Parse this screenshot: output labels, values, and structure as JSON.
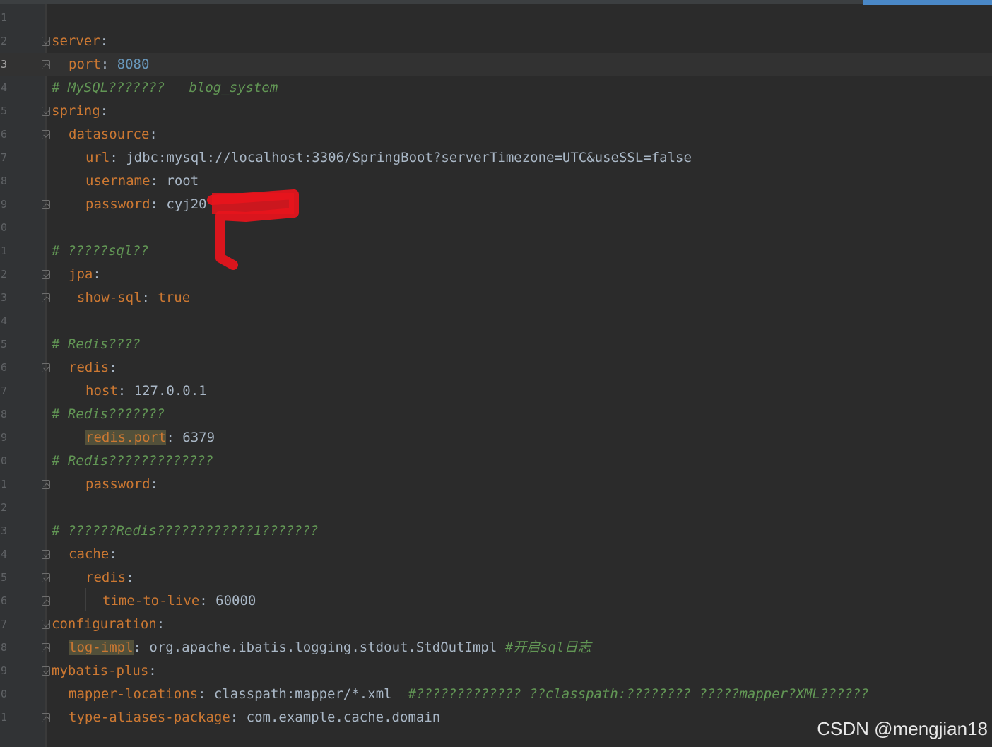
{
  "editor": {
    "file_type": "yaml",
    "current_line": 3,
    "lines": [
      {
        "num": "1",
        "fold": "",
        "indent": 0,
        "parts": []
      },
      {
        "num": "2",
        "fold": "open",
        "indent": 0,
        "parts": [
          {
            "t": "server",
            "c": "key"
          },
          {
            "t": ":",
            "c": "val"
          }
        ]
      },
      {
        "num": "3",
        "fold": "close",
        "indent": 1,
        "parts": [
          {
            "t": "port",
            "c": "key"
          },
          {
            "t": ": ",
            "c": "val"
          },
          {
            "t": "8080",
            "c": "num"
          }
        ]
      },
      {
        "num": "4",
        "fold": "",
        "indent": 0,
        "parts": [
          {
            "t": "# MySQL???????   blog_system",
            "c": "cmt"
          }
        ]
      },
      {
        "num": "5",
        "fold": "open",
        "indent": 0,
        "parts": [
          {
            "t": "spring",
            "c": "key"
          },
          {
            "t": ":",
            "c": "val"
          }
        ]
      },
      {
        "num": "6",
        "fold": "open",
        "indent": 1,
        "parts": [
          {
            "t": "datasource",
            "c": "key"
          },
          {
            "t": ":",
            "c": "val"
          }
        ]
      },
      {
        "num": "7",
        "fold": "",
        "indent": 2,
        "parts": [
          {
            "t": "url",
            "c": "key"
          },
          {
            "t": ": jdbc:mysql://localhost:3306/SpringBoot?serverTimezone=UTC&useSSL=false",
            "c": "val"
          }
        ]
      },
      {
        "num": "8",
        "fold": "",
        "indent": 2,
        "parts": [
          {
            "t": "username",
            "c": "key"
          },
          {
            "t": ": root",
            "c": "val"
          }
        ]
      },
      {
        "num": "9",
        "fold": "close",
        "indent": 2,
        "parts": [
          {
            "t": "password",
            "c": "key"
          },
          {
            "t": ": cyj20",
            "c": "val"
          }
        ]
      },
      {
        "num": "0",
        "fold": "",
        "indent": 0,
        "parts": []
      },
      {
        "num": "1",
        "fold": "",
        "indent": 0,
        "parts": [
          {
            "t": "# ?????sql??",
            "c": "cmt"
          }
        ]
      },
      {
        "num": "2",
        "fold": "open",
        "indent": 1,
        "parts": [
          {
            "t": "jpa",
            "c": "key"
          },
          {
            "t": ":",
            "c": "val"
          }
        ]
      },
      {
        "num": "3",
        "fold": "close",
        "indent": 1.5,
        "parts": [
          {
            "t": "show-sql",
            "c": "key"
          },
          {
            "t": ": ",
            "c": "val"
          },
          {
            "t": "true",
            "c": "key"
          }
        ]
      },
      {
        "num": "4",
        "fold": "",
        "indent": 0,
        "parts": []
      },
      {
        "num": "5",
        "fold": "",
        "indent": 0,
        "parts": [
          {
            "t": "# Redis????",
            "c": "cmt"
          }
        ]
      },
      {
        "num": "6",
        "fold": "open",
        "indent": 1,
        "parts": [
          {
            "t": "redis",
            "c": "key"
          },
          {
            "t": ":",
            "c": "val"
          }
        ]
      },
      {
        "num": "7",
        "fold": "",
        "indent": 2,
        "parts": [
          {
            "t": "host",
            "c": "key"
          },
          {
            "t": ": 127.0.0.1",
            "c": "val"
          }
        ]
      },
      {
        "num": "8",
        "fold": "",
        "indent": 0,
        "parts": [
          {
            "t": "# Redis???????",
            "c": "cmt"
          }
        ]
      },
      {
        "num": "9",
        "fold": "",
        "indent": 2,
        "parts": [
          {
            "t": "redis.port",
            "c": "key hl"
          },
          {
            "t": ": 6379",
            "c": "val"
          }
        ]
      },
      {
        "num": "0",
        "fold": "",
        "indent": 0,
        "parts": [
          {
            "t": "# Redis?????????????",
            "c": "cmt"
          }
        ]
      },
      {
        "num": "1",
        "fold": "close",
        "indent": 2,
        "parts": [
          {
            "t": "password",
            "c": "key"
          },
          {
            "t": ":",
            "c": "val"
          }
        ]
      },
      {
        "num": "2",
        "fold": "",
        "indent": 0,
        "parts": []
      },
      {
        "num": "3",
        "fold": "",
        "indent": 0,
        "parts": [
          {
            "t": "# ??????Redis????????????1???????",
            "c": "cmt"
          }
        ]
      },
      {
        "num": "4",
        "fold": "open",
        "indent": 1,
        "parts": [
          {
            "t": "cache",
            "c": "key"
          },
          {
            "t": ":",
            "c": "val"
          }
        ]
      },
      {
        "num": "5",
        "fold": "open",
        "indent": 2,
        "parts": [
          {
            "t": "redis",
            "c": "key"
          },
          {
            "t": ":",
            "c": "val"
          }
        ]
      },
      {
        "num": "6",
        "fold": "close",
        "indent": 3,
        "parts": [
          {
            "t": "time-to-live",
            "c": "key"
          },
          {
            "t": ": 60000",
            "c": "val"
          }
        ]
      },
      {
        "num": "7",
        "fold": "open",
        "indent": 0,
        "parts": [
          {
            "t": "configuration",
            "c": "key"
          },
          {
            "t": ":",
            "c": "val"
          }
        ]
      },
      {
        "num": "8",
        "fold": "close",
        "indent": 1,
        "parts": [
          {
            "t": "log-impl",
            "c": "key hl"
          },
          {
            "t": ": org.apache.ibatis.logging.stdout.StdOutImpl ",
            "c": "val"
          },
          {
            "t": "#开启sql日志",
            "c": "cmt"
          }
        ]
      },
      {
        "num": "9",
        "fold": "open",
        "indent": 0,
        "parts": [
          {
            "t": "mybatis-plus",
            "c": "key"
          },
          {
            "t": ":",
            "c": "val"
          }
        ]
      },
      {
        "num": "0",
        "fold": "",
        "indent": 1,
        "parts": [
          {
            "t": "mapper-locations",
            "c": "key"
          },
          {
            "t": ": classpath:mapper/*.xml  ",
            "c": "val"
          },
          {
            "t": "#????????????? ??classpath:???????? ?????mapper?XML??????",
            "c": "cmt"
          }
        ]
      },
      {
        "num": "1",
        "fold": "close",
        "indent": 1,
        "parts": [
          {
            "t": "type-aliases-package",
            "c": "key"
          },
          {
            "t": ": com.example.cache.domain",
            "c": "val"
          }
        ]
      }
    ]
  },
  "watermark": "CSDN @mengjian18",
  "colors": {
    "background": "#2b2b2b",
    "key": "#cc7832",
    "comment": "#629755",
    "number": "#6897bb",
    "text": "#a9b7c6",
    "redaction": "#e8141c"
  }
}
